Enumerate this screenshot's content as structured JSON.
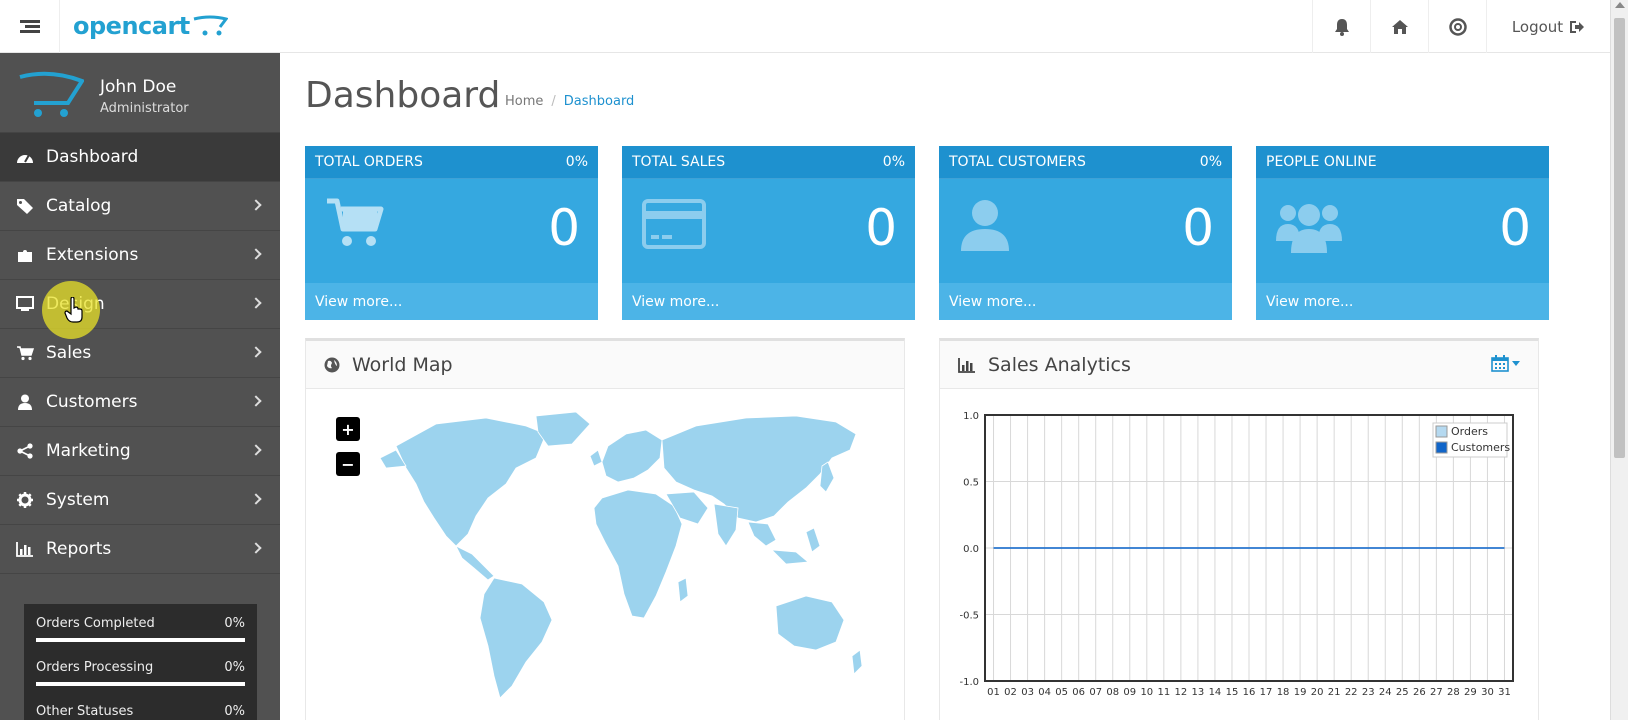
{
  "header": {
    "logo_text": "opencart",
    "logout_label": "Logout"
  },
  "sidebar": {
    "user_name": "John Doe",
    "user_role": "Administrator",
    "items": [
      {
        "label": "Dashboard",
        "icon": "dashboard-icon"
      },
      {
        "label": "Catalog",
        "icon": "tags-icon"
      },
      {
        "label": "Extensions",
        "icon": "puzzle-icon"
      },
      {
        "label": "Design",
        "icon": "monitor-icon"
      },
      {
        "label": "Sales",
        "icon": "cart-icon"
      },
      {
        "label": "Customers",
        "icon": "user-icon"
      },
      {
        "label": "Marketing",
        "icon": "share-icon"
      },
      {
        "label": "System",
        "icon": "gear-icon"
      },
      {
        "label": "Reports",
        "icon": "bar-chart-icon"
      }
    ],
    "stats": [
      {
        "label": "Orders Completed",
        "value": "0%"
      },
      {
        "label": "Orders Processing",
        "value": "0%"
      },
      {
        "label": "Other Statuses",
        "value": "0%"
      }
    ]
  },
  "main": {
    "title": "Dashboard",
    "breadcrumb": {
      "home": "Home",
      "sep": "/",
      "current": "Dashboard"
    },
    "tiles": [
      {
        "title": "TOTAL ORDERS",
        "percent": "0%",
        "value": "0",
        "link": "View more...",
        "icon": "cart-icon"
      },
      {
        "title": "TOTAL SALES",
        "percent": "0%",
        "value": "0",
        "link": "View more...",
        "icon": "credit-card-icon"
      },
      {
        "title": "TOTAL CUSTOMERS",
        "percent": "0%",
        "value": "0",
        "link": "View more...",
        "icon": "user-icon"
      },
      {
        "title": "PEOPLE ONLINE",
        "percent": "",
        "value": "0",
        "link": "View more...",
        "icon": "users-icon"
      }
    ],
    "world_map": {
      "title": "World Map",
      "zoom_in": "+",
      "zoom_out": "−"
    },
    "sales_analytics": {
      "title": "Sales Analytics"
    }
  },
  "colors": {
    "brand": "#23a1d1",
    "tile": "#1e91cf",
    "sidebar": "#515151",
    "map_land": "#9cd3ee",
    "customers_series": "#1065c9"
  },
  "chart_data": {
    "type": "line",
    "title": "",
    "xlabel": "",
    "ylabel": "",
    "ylim": [
      -1.0,
      1.0
    ],
    "yticks": [
      "1.0",
      "0.5",
      "0.0",
      "-0.5",
      "-1.0"
    ],
    "categories": [
      "01",
      "02",
      "03",
      "04",
      "05",
      "06",
      "07",
      "08",
      "09",
      "10",
      "11",
      "12",
      "13",
      "14",
      "15",
      "16",
      "17",
      "18",
      "19",
      "20",
      "21",
      "22",
      "23",
      "24",
      "25",
      "26",
      "27",
      "28",
      "29",
      "30",
      "31"
    ],
    "series": [
      {
        "name": "Orders",
        "color": "#b5d9f0",
        "values": [
          0,
          0,
          0,
          0,
          0,
          0,
          0,
          0,
          0,
          0,
          0,
          0,
          0,
          0,
          0,
          0,
          0,
          0,
          0,
          0,
          0,
          0,
          0,
          0,
          0,
          0,
          0,
          0,
          0,
          0,
          0
        ]
      },
      {
        "name": "Customers",
        "color": "#1065c9",
        "values": [
          0,
          0,
          0,
          0,
          0,
          0,
          0,
          0,
          0,
          0,
          0,
          0,
          0,
          0,
          0,
          0,
          0,
          0,
          0,
          0,
          0,
          0,
          0,
          0,
          0,
          0,
          0,
          0,
          0,
          0,
          0
        ]
      }
    ],
    "legend": "top-right",
    "grid": true
  }
}
